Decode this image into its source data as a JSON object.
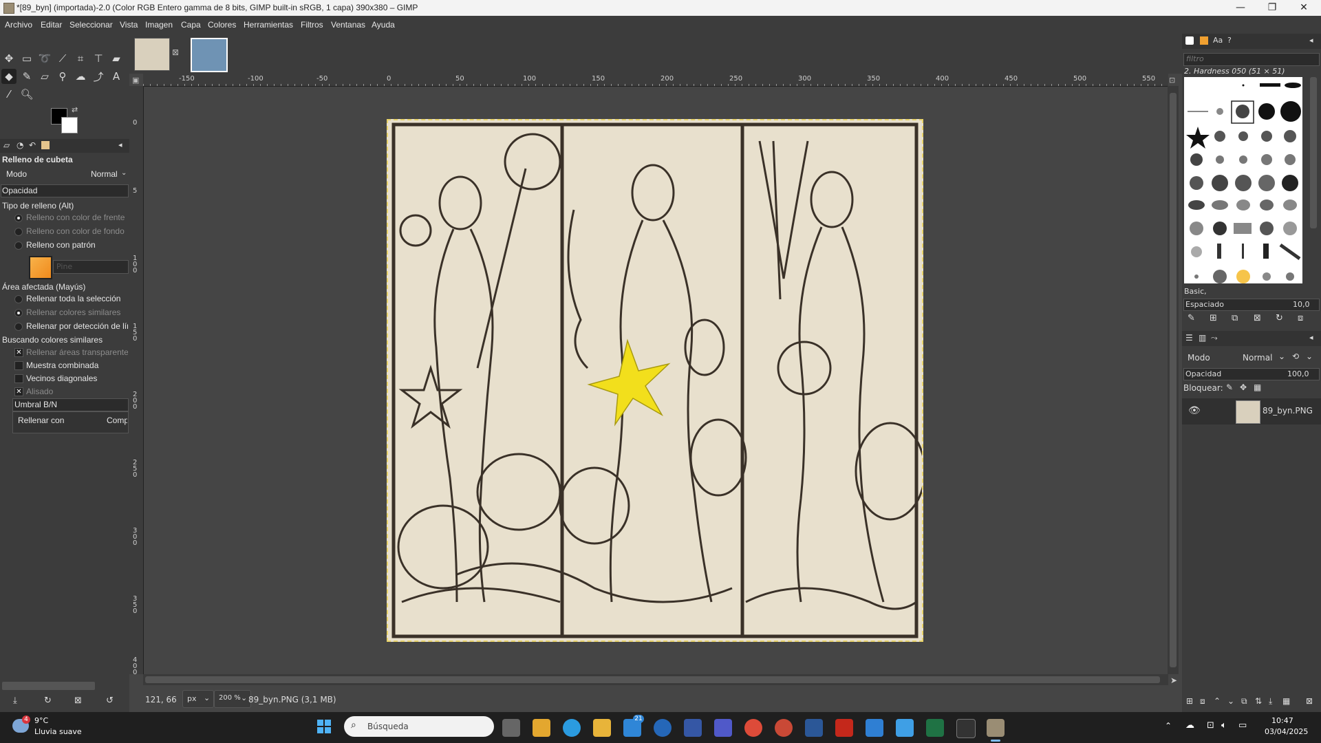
{
  "window": {
    "title": "*[89_byn] (importada)-2.0 (Color RGB Entero gamma de 8 bits, GIMP built-in sRGB, 1 capa) 390x380 – GIMP",
    "minimize": "—",
    "maximize": "❐",
    "close": "✕"
  },
  "menu": [
    "Archivo",
    "Editar",
    "Seleccionar",
    "Vista",
    "Imagen",
    "Capa",
    "Colores",
    "Herramientas",
    "Filtros",
    "Ventanas",
    "Ayuda"
  ],
  "tool_options": {
    "title": "Relleno de cubeta",
    "mode_label": "Modo",
    "mode_value": "Normal",
    "opacity_label": "Opacidad",
    "fill_type_label": "Tipo de relleno  (Alt)",
    "fill_fg": "Relleno con color de frente",
    "fill_bg": "Relleno con color de fondo",
    "fill_pattern": "Relleno con patrón",
    "pattern_name": "Pine",
    "area_label": "Área afectada  (Mayús)",
    "area_selection": "Rellenar toda la selección",
    "area_similar": "Rellenar colores similares",
    "area_line": "Rellenar por detección de línea",
    "finding_label": "Buscando colores similares",
    "fill_transparent": "Rellenar áreas transparentes",
    "sample_merged": "Muestra combinada",
    "diagonal": "Vecinos diagonales",
    "antialias": "Alisado",
    "threshold": "Umbral B/N",
    "fill_with_label": "Rellenar con",
    "fill_with_value": "Composite"
  },
  "ruler_labels": [
    "-150",
    "-100",
    "-50",
    "0",
    "50",
    "100",
    "150",
    "200",
    "250",
    "300",
    "350",
    "400",
    "450",
    "500",
    "550"
  ],
  "vruler_labels": [
    "0",
    "5",
    "1 0 0",
    "1 5 0",
    "2 0 0",
    "2 5 0",
    "3 0 0",
    "3 5 0",
    "4 0 0"
  ],
  "status": {
    "coords": "121, 66",
    "unit": "px",
    "zoom": "200 %",
    "file": "89_byn.PNG (3,1 MB)"
  },
  "brushes": {
    "filter_placeholder": "filtro",
    "current": "2. Hardness 050 (51 × 51)",
    "tag": "Basic,",
    "spacing_label": "Espaciado",
    "spacing_value": "10,0"
  },
  "layers": {
    "mode_label": "Modo",
    "mode_value": "Normal",
    "opacity_label": "Opacidad",
    "opacity_value": "100,0",
    "lock_label": "Bloquear:",
    "layer_name": "89_byn.PNG"
  },
  "taskbar": {
    "weather_badge": "4",
    "temperature": "9°C",
    "weather_desc": "Lluvia suave",
    "search_placeholder": "Búsqueda",
    "mail_badge": "21",
    "time": "10:47",
    "date": "03/04/2025"
  },
  "colors": {
    "accent_yellow": "#f2df1c",
    "selection_dash": "#e8d36a"
  }
}
